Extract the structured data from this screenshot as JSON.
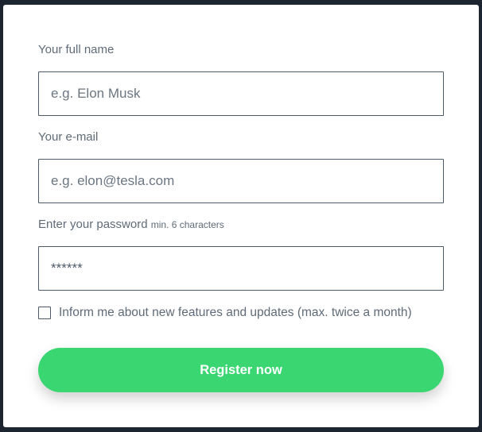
{
  "form": {
    "name_label": "Your full name",
    "name_placeholder": "e.g. Elon Musk",
    "email_label": "Your e-mail",
    "email_placeholder": "e.g. elon@tesla.com",
    "password_label": "Enter your password",
    "password_hint": "min. 6 characters",
    "password_value": "******",
    "newsletter_label": "Inform me about new features and updates (max. twice a month)",
    "newsletter_checked": false,
    "register_label": "Register now"
  },
  "colors": {
    "accent": "#3ad672",
    "text": "#5f6b78",
    "border": "#4e5b69",
    "backdrop": "#1d2530"
  }
}
